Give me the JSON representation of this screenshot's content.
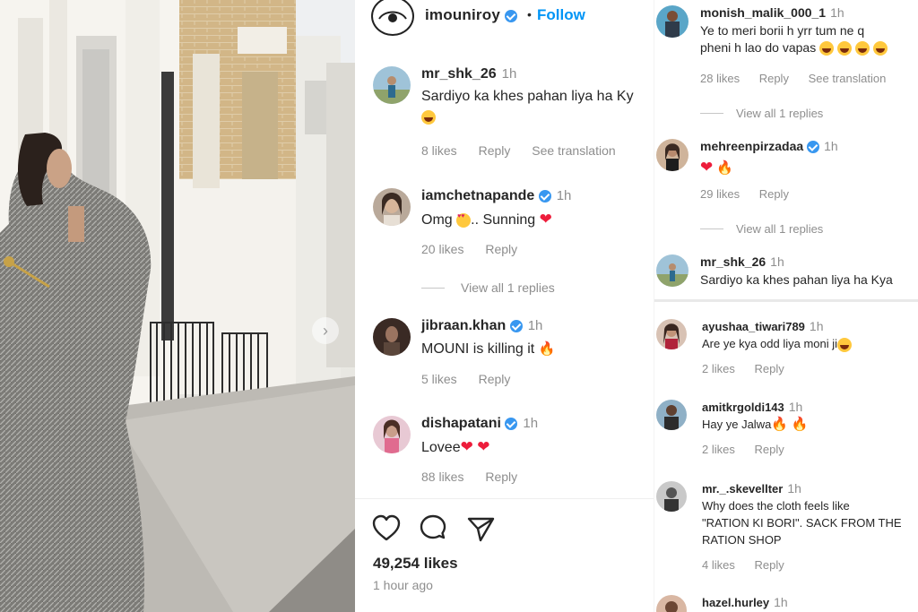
{
  "post": {
    "username": "imouniroy",
    "follow_label": "Follow",
    "dot": "•",
    "likes": "49,254 likes",
    "time": "1 hour ago"
  },
  "comments": [
    {
      "user": "mr_shk_26",
      "time": "1h",
      "text": "Sardiyo ka khes pahan liya ha Ky",
      "likes": "8 likes",
      "reply": "Reply",
      "translate": "See translation"
    },
    {
      "user": "iamchetnapande",
      "time": "1h",
      "text_a": "Omg",
      "text_b": ".. Sunning",
      "likes": "20 likes",
      "reply": "Reply",
      "view_replies": "View all 1 replies"
    },
    {
      "user": "jibraan.khan",
      "time": "1h",
      "text": "MOUNI is killing it",
      "likes": "5 likes",
      "reply": "Reply"
    },
    {
      "user": "dishapatani",
      "time": "1h",
      "text": "Lovee",
      "likes": "88 likes",
      "reply": "Reply"
    }
  ],
  "right_comments": [
    {
      "user": "monish_malik_000_1",
      "time": "1h",
      "line1": "Ye to meri borii h yrr tum ne q",
      "line2": "pheni h lao do vapas",
      "likes": "28 likes",
      "reply": "Reply",
      "translate": "See translation",
      "view_replies": "View all 1 replies"
    },
    {
      "user": "mehreenpirzadaa",
      "time": "1h",
      "likes": "29 likes",
      "reply": "Reply",
      "view_replies": "View all 1 replies"
    },
    {
      "user": "mr_shk_26",
      "time": "1h",
      "text": "Sardiyo ka khes pahan liya ha Kya"
    },
    {
      "user": "ayushaa_tiwari789",
      "time": "1h",
      "text": "Are ye kya odd liya moni ji",
      "likes": "2 likes",
      "reply": "Reply"
    },
    {
      "user": "amitkrgoldi143",
      "time": "1h",
      "text": "Hay ye Jalwa",
      "likes": "2 likes",
      "reply": "Reply"
    },
    {
      "user": "mr._.skevellter",
      "time": "1h",
      "line1": "Why does the cloth feels like",
      "line2": "\"RATION KI BORI\". SACK FROM THE",
      "line3": "RATION SHOP",
      "likes": "4 likes",
      "reply": "Reply"
    },
    {
      "user": "hazel.hurley",
      "time": "1h"
    }
  ],
  "icons": {
    "heart": "heart-icon",
    "comment": "comment-icon",
    "share": "share-icon",
    "verified": "verified-badge-icon",
    "carousel": "chevron-right-icon"
  },
  "colors": {
    "accent": "#0095f6",
    "verified": "#3897f0",
    "heart": "#ed1d3b"
  }
}
